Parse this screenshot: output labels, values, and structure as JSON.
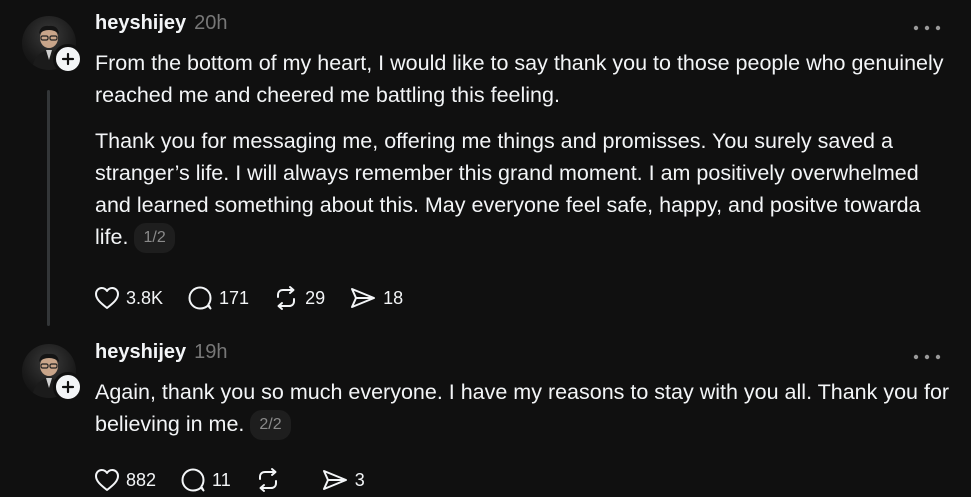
{
  "posts": [
    {
      "username": "heyshijey",
      "time": "20h",
      "paragraphs": [
        "From the bottom of my heart, I would like to say thank you to those people who genuinely reached me and cheered me battling this feeling.",
        "Thank you for messaging me, offering me things and promisses. You surely saved a stranger’s life. I will always remember this grand moment. I am positively overwhelmed and learned something about this. May everyone feel safe, happy, and positve towarda life."
      ],
      "page_label": "1/2",
      "likes": "3.8K",
      "replies": "171",
      "reposts": "29",
      "shares": "18"
    },
    {
      "username": "heyshijey",
      "time": "19h",
      "paragraphs": [
        "Again, thank you so much everyone. I have my reasons to stay with you all. Thank you for believing in me."
      ],
      "page_label": "2/2",
      "likes": "882",
      "replies": "11",
      "reposts": "",
      "shares": "3"
    }
  ],
  "icons": {
    "like": "heart-icon",
    "reply": "speech-bubble-icon",
    "repost": "repost-icon",
    "share": "send-icon",
    "more": "more-horizontal-icon",
    "follow": "plus-icon"
  },
  "colors": {
    "background": "#101010",
    "text": "#f3f5f7",
    "muted": "#777777",
    "thread_line": "#333638"
  }
}
